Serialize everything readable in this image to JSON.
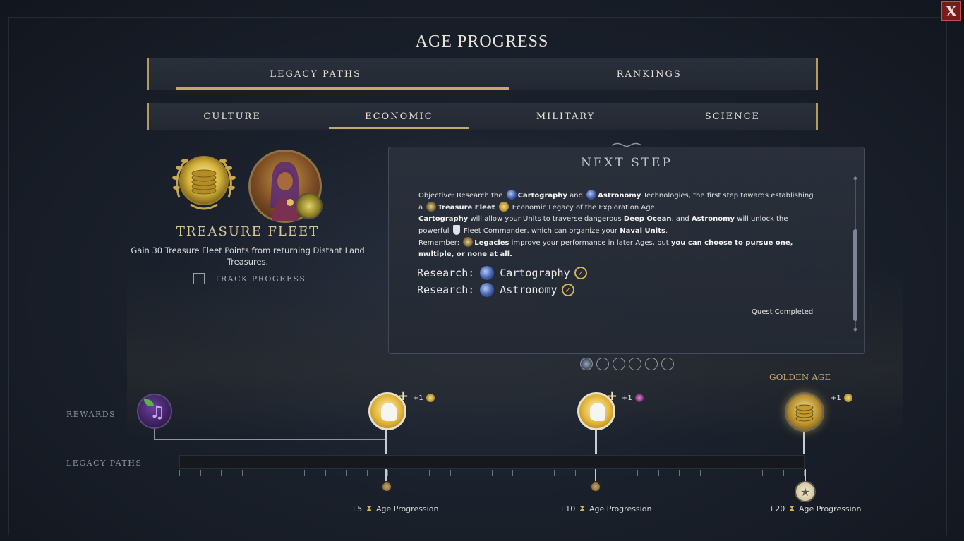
{
  "window": {
    "title": "AGE PROGRESS",
    "close_label": "X"
  },
  "main_tabs": [
    {
      "label": "LEGACY PATHS",
      "active": true
    },
    {
      "label": "RANKINGS",
      "active": false
    }
  ],
  "path_tabs": [
    {
      "label": "CULTURE",
      "active": false
    },
    {
      "label": "ECONOMIC",
      "active": true
    },
    {
      "label": "MILITARY",
      "active": false
    },
    {
      "label": "SCIENCE",
      "active": false
    }
  ],
  "objective": {
    "title": "TREASURE FLEET",
    "description": "Gain 30 Treasure Fleet Points from returning Distant Land Treasures.",
    "track_label": "TRACK PROGRESS",
    "track_checked": false
  },
  "next_step": {
    "title": "NEXT STEP",
    "objective_prefix": "Objective: Research the",
    "tech1": "Cartography",
    "and": "and",
    "tech2": "Astronomy",
    "objective_suffix": "Technologies, the first step towards establishing a",
    "legacy_name": "Treasure Fleet",
    "legacy_suffix": "Economic Legacy of the Exploration Age.",
    "line2_tech1": "Cartography",
    "line2_mid": "will allow your Units to traverse dangerous",
    "line2_deep": "Deep Ocean",
    "line2_and": ", and",
    "line2_tech2": "Astronomy",
    "line2_end": "will unlock the",
    "line3_pre": "powerful",
    "line3_mid": "Fleet Commander, which can organize your",
    "line3_units": "Naval Units",
    "line3_end": ".",
    "remember_prefix": "Remember:",
    "legacies": "Legacies",
    "remember_mid": "improve your performance in later Ages, but",
    "remember_bold": "you can choose to pursue one, multiple, or none at all.",
    "research_items": [
      {
        "prefix": "Research:",
        "tech": "Cartography",
        "done": true
      },
      {
        "prefix": "Research:",
        "tech": "Astronomy",
        "done": true
      }
    ],
    "quest_status": "Quest Completed",
    "check_glyph": "✓"
  },
  "pagination": {
    "count": 6,
    "active_index": 0
  },
  "timeline": {
    "rewards_label": "REWARDS",
    "legacy_paths_label": "LEGACY PATHS",
    "golden_age_label": "GOLDEN AGE",
    "bonus1": "+1",
    "bonus2": "+1",
    "bonus3": "+1",
    "milestones": [
      {
        "value": "+5",
        "label": "Age Progression"
      },
      {
        "value": "+10",
        "label": "Age Progression"
      },
      {
        "value": "+20",
        "label": "Age Progression"
      }
    ],
    "progress": 0.0
  },
  "icons": {
    "close": "close-icon",
    "culture_reward": "music-note-icon",
    "great_person": "great-person-icon",
    "gold_coins": "gold-coins-icon",
    "hourglass": "hourglass-icon",
    "star": "star-icon",
    "globe": "technology-globe-icon"
  },
  "colors": {
    "accent_gold": "#c3a96d",
    "close_red": "#7a1a1a",
    "panel_bg": "#2b313c"
  }
}
